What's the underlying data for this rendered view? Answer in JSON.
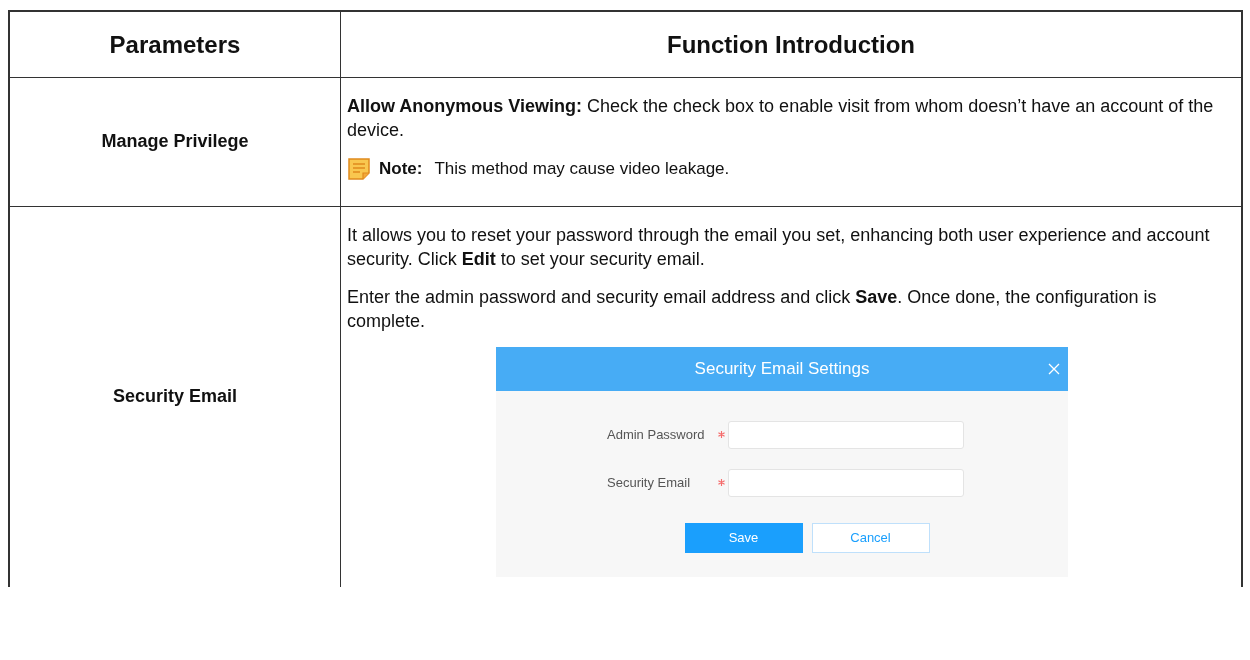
{
  "table": {
    "columns": [
      "Parameters",
      "Function Introduction"
    ],
    "rows": [
      {
        "parameter": "Manage Privilege",
        "content": [
          {
            "kind": "paragraph",
            "text": "**Allow Anonymous Viewing:** Check the check box to enable visit from whom doesn’t have an account of the device."
          },
          {
            "kind": "note",
            "label": "Note:",
            "text": "This method may cause video leakage."
          }
        ]
      },
      {
        "parameter": "Security Email",
        "content": [
          {
            "kind": "paragraph",
            "text": "It allows you to reset your password through the email you set, enhancing both user experience and account security. Click **Edit** to set your security email."
          },
          {
            "kind": "paragraph",
            "text": "Enter the admin password and security email address and click **Save**. Once done, the configuration is complete."
          },
          {
            "kind": "dialog",
            "title": "Security Email Settings",
            "fields": [
              {
                "label": "Admin Password",
                "required": true
              },
              {
                "label": "Security Email",
                "required": true
              }
            ],
            "buttons": [
              {
                "label": "Save",
                "primary": true
              },
              {
                "label": "Cancel",
                "primary": false
              }
            ]
          }
        ]
      }
    ]
  }
}
